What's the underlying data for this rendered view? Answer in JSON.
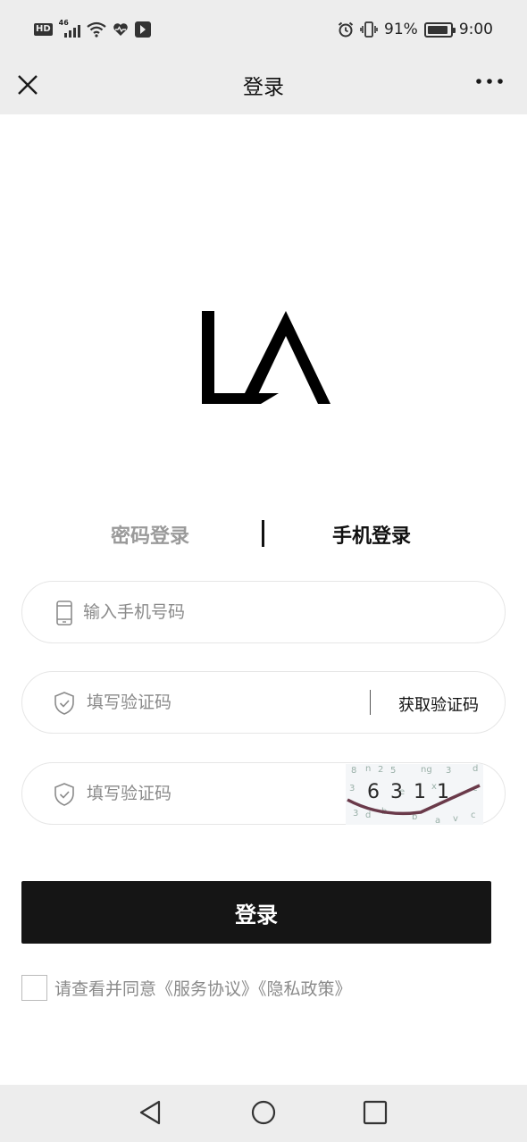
{
  "status_bar": {
    "hd_label": "HD",
    "network_label": "46",
    "battery_percent": 91,
    "battery_text": "91%",
    "time": "9:00",
    "icons": [
      "hd-icon",
      "signal-icon",
      "wifi-icon",
      "health-icon",
      "app-icon",
      "alarm-icon",
      "vibrate-icon",
      "battery-icon"
    ]
  },
  "header": {
    "title": "登录",
    "close_icon": "close-icon",
    "more_icon": "more-icon"
  },
  "logo": {
    "text": "LA"
  },
  "tabs": [
    {
      "label": "密码登录",
      "active": false
    },
    {
      "label": "手机登录",
      "active": true
    }
  ],
  "form": {
    "phone": {
      "placeholder": "输入手机号码",
      "value": "",
      "icon": "phone-icon"
    },
    "sms_code": {
      "placeholder": "填写验证码",
      "value": "",
      "icon": "shield-icon",
      "action_label": "获取验证码"
    },
    "captcha": {
      "placeholder": "填写验证码",
      "value": "",
      "icon": "shield-icon",
      "image_text": "6311"
    }
  },
  "login_button": {
    "label": "登录"
  },
  "agreement": {
    "prefix": "请查看并同意",
    "service_link": "《服务协议》",
    "privacy_link": "《隐私政策》",
    "checked": false
  },
  "colors": {
    "bar_background": "#ededed",
    "primary_button": "#151515",
    "active_tab": "#111111",
    "inactive_tab": "#9a9a9a",
    "placeholder": "#8a8a8a"
  }
}
